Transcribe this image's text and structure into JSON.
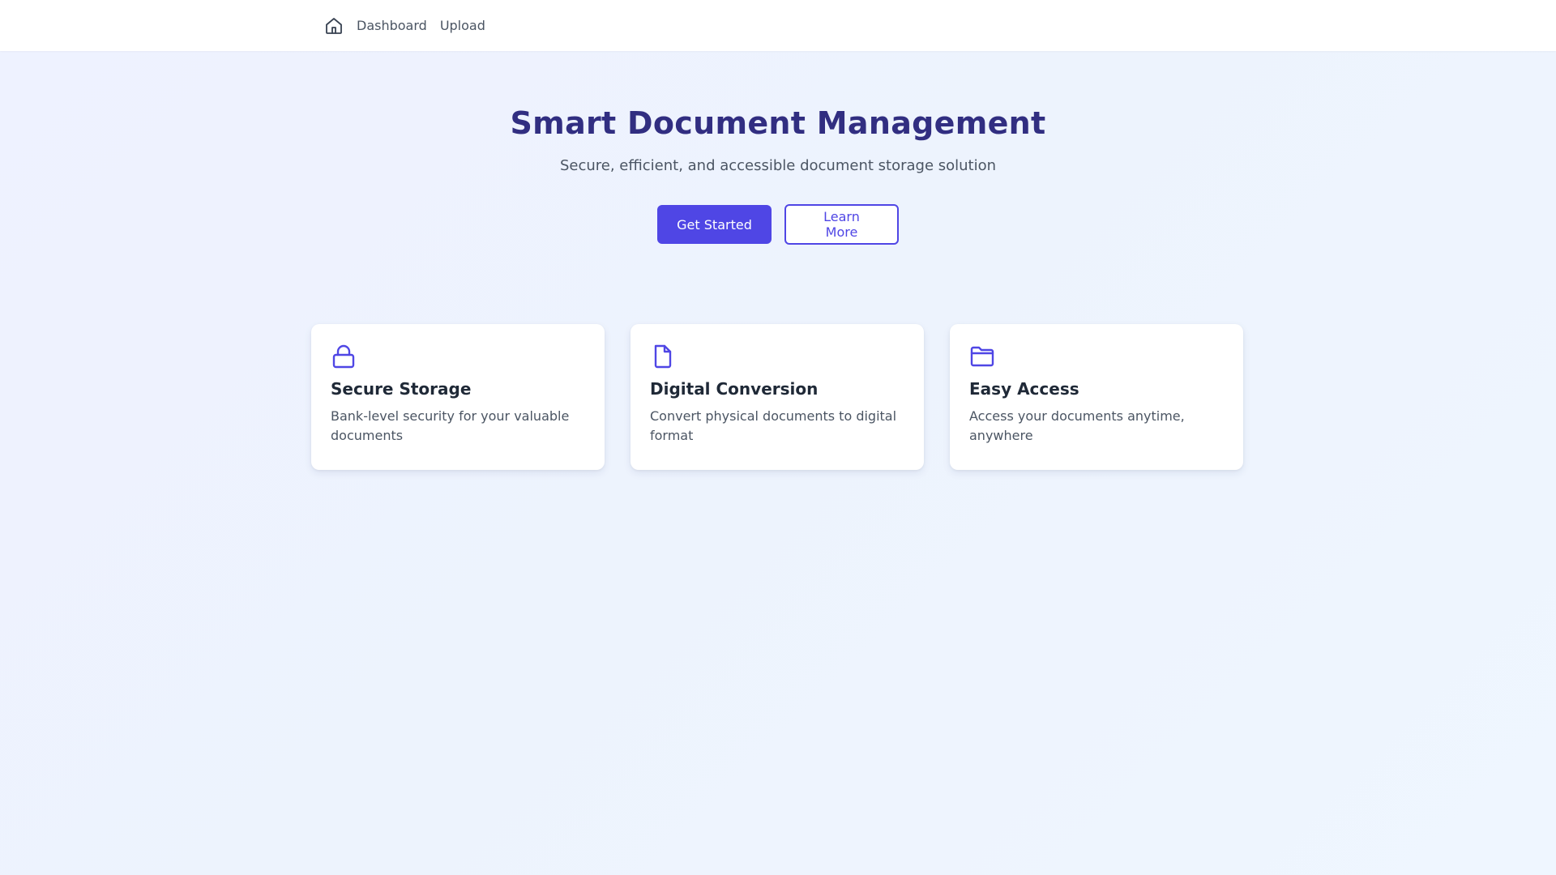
{
  "nav": {
    "home_icon": "home-icon",
    "links": [
      {
        "label": "Dashboard"
      },
      {
        "label": "Upload"
      }
    ]
  },
  "hero": {
    "title": "Smart Document Management",
    "subtitle": "Secure, efficient, and accessible document storage solution",
    "primary_label": "Get Started",
    "secondary_label": "Learn More"
  },
  "features": [
    {
      "icon": "lock-icon",
      "title": "Secure Storage",
      "description": "Bank-level security for your valuable documents"
    },
    {
      "icon": "document-icon",
      "title": "Digital Conversion",
      "description": "Convert physical documents to digital format"
    },
    {
      "icon": "folder-icon",
      "title": "Easy Access",
      "description": "Access your documents anytime, anywhere"
    }
  ],
  "colors": {
    "accent": "#4f46e5",
    "title": "#312e81",
    "background": "#eef2ff",
    "text_muted": "#4b5563"
  }
}
